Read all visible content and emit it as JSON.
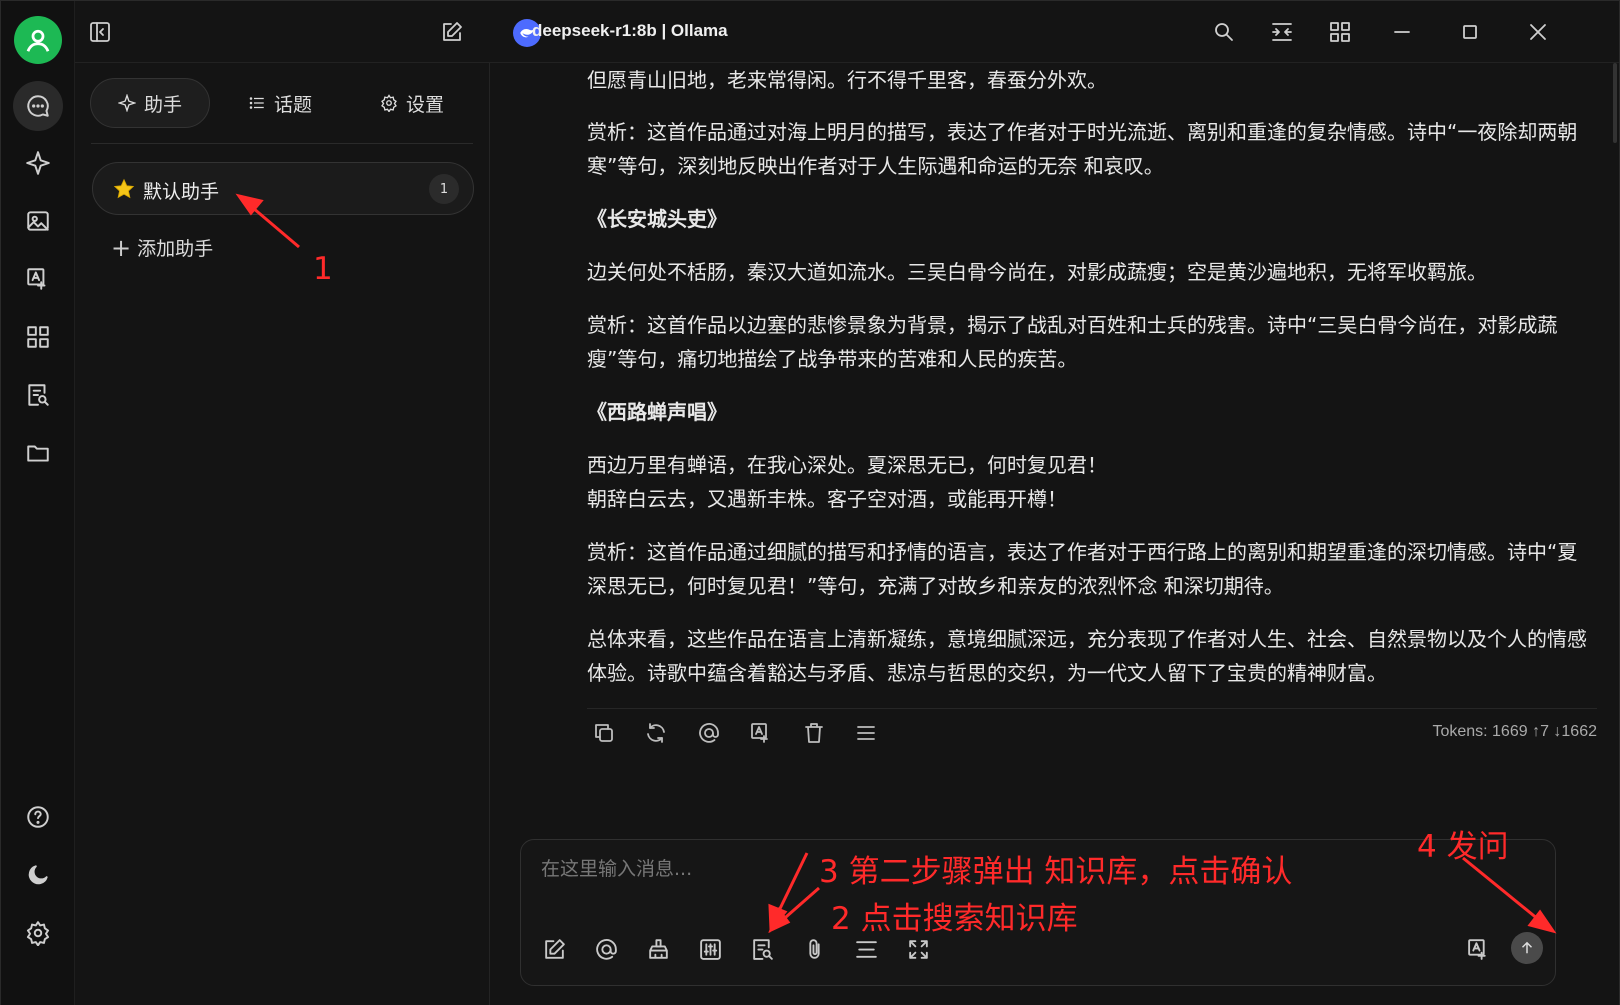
{
  "window": {
    "model_title": "deepseek-r1:8b | Ollama"
  },
  "rail": {
    "items": [
      "chat-icon",
      "sparkle-icon",
      "image-icon",
      "translate-icon",
      "apps-icon",
      "knowledge-search-icon",
      "folder-icon"
    ],
    "bottom": [
      "help-icon",
      "moon-icon",
      "settings-gear-icon"
    ]
  },
  "panel": {
    "tabs": [
      {
        "label": "助手",
        "icon": "sparkle-icon",
        "active": true
      },
      {
        "label": "话题",
        "icon": "list-icon",
        "active": false
      },
      {
        "label": "设置",
        "icon": "gear-icon",
        "active": false
      }
    ],
    "assistant": {
      "name": "默认助手",
      "count": "1"
    },
    "add_label": "添加助手"
  },
  "messages": [
    {
      "text": "但愿青山旧地，老来常得闲。行不得千里客，春蚕分外欢。",
      "heading": false
    },
    {
      "text": "赏析：这首作品通过对海上明月的描写，表达了作者对于时光流逝、离别和重逢的复杂情感。诗中“一夜除却两朝寒”等句，深刻地反映出作者对于人生际遇和命运的无奈 和哀叹。",
      "heading": false
    },
    {
      "text": "《长安城头吏》",
      "heading": true
    },
    {
      "text": "边关何处不栝肠，秦汉大道如流水。三吴白骨今尚在，对影成蔬瘦；空是黄沙遍地积，无将军收羁旅。",
      "heading": false
    },
    {
      "text": "赏析：这首作品以边塞的悲惨景象为背景，揭示了战乱对百姓和士兵的残害。诗中“三吴白骨今尚在，对影成蔬瘦”等句，痛切地描绘了战争带来的苦难和人民的疾苦。",
      "heading": false
    },
    {
      "text": "《西路蝉声唱》",
      "heading": true
    },
    {
      "text": "西边万里有蝉语，在我心深处。夏深思无已，何时复见君！\n朝辞白云去，又遇新丰株。客子空对酒，或能再开樽！",
      "heading": false
    },
    {
      "text": "赏析：这首作品通过细腻的描写和抒情的语言，表达了作者对于西行路上的离别和期望重逢的深切情感。诗中“夏深思无已，何时复见君！”等句，充满了对故乡和亲友的浓烈怀念 和深切期待。",
      "heading": false
    },
    {
      "text": "总体来看，这些作品在语言上清新凝练，意境细腻深远，充分表现了作者对人生、社会、自然景物以及个人的情感体验。诗歌中蕴含着豁达与矛盾、悲凉与哲思的交织，为一代文人留下了宝贵的精神财富。",
      "heading": false
    }
  ],
  "message_actions": [
    "copy-icon",
    "regenerate-icon",
    "mention-icon",
    "translate-icon",
    "delete-icon",
    "menu-icon"
  ],
  "tokens": "Tokens: 1669 ↑7 ↓1662",
  "input": {
    "placeholder": "在这里输入消息...",
    "tools": [
      "new-topic-icon",
      "mention-icon",
      "clear-icon",
      "settings-sliders-icon",
      "knowledge-base-icon",
      "attachment-icon",
      "divider-icon",
      "expand-icon"
    ],
    "right_tools": [
      "translate-icon",
      "send-icon"
    ]
  },
  "annotations": {
    "a1": "1",
    "a2": "2 点击搜索知识库",
    "a3": "3 第二步骤弹出 知识库，点击确认",
    "a4": "4 发问",
    "color": "#ff2a2a"
  },
  "colors": {
    "avatar": "#1db954",
    "model_logo": "#4d6bfe",
    "background": "#141414"
  }
}
